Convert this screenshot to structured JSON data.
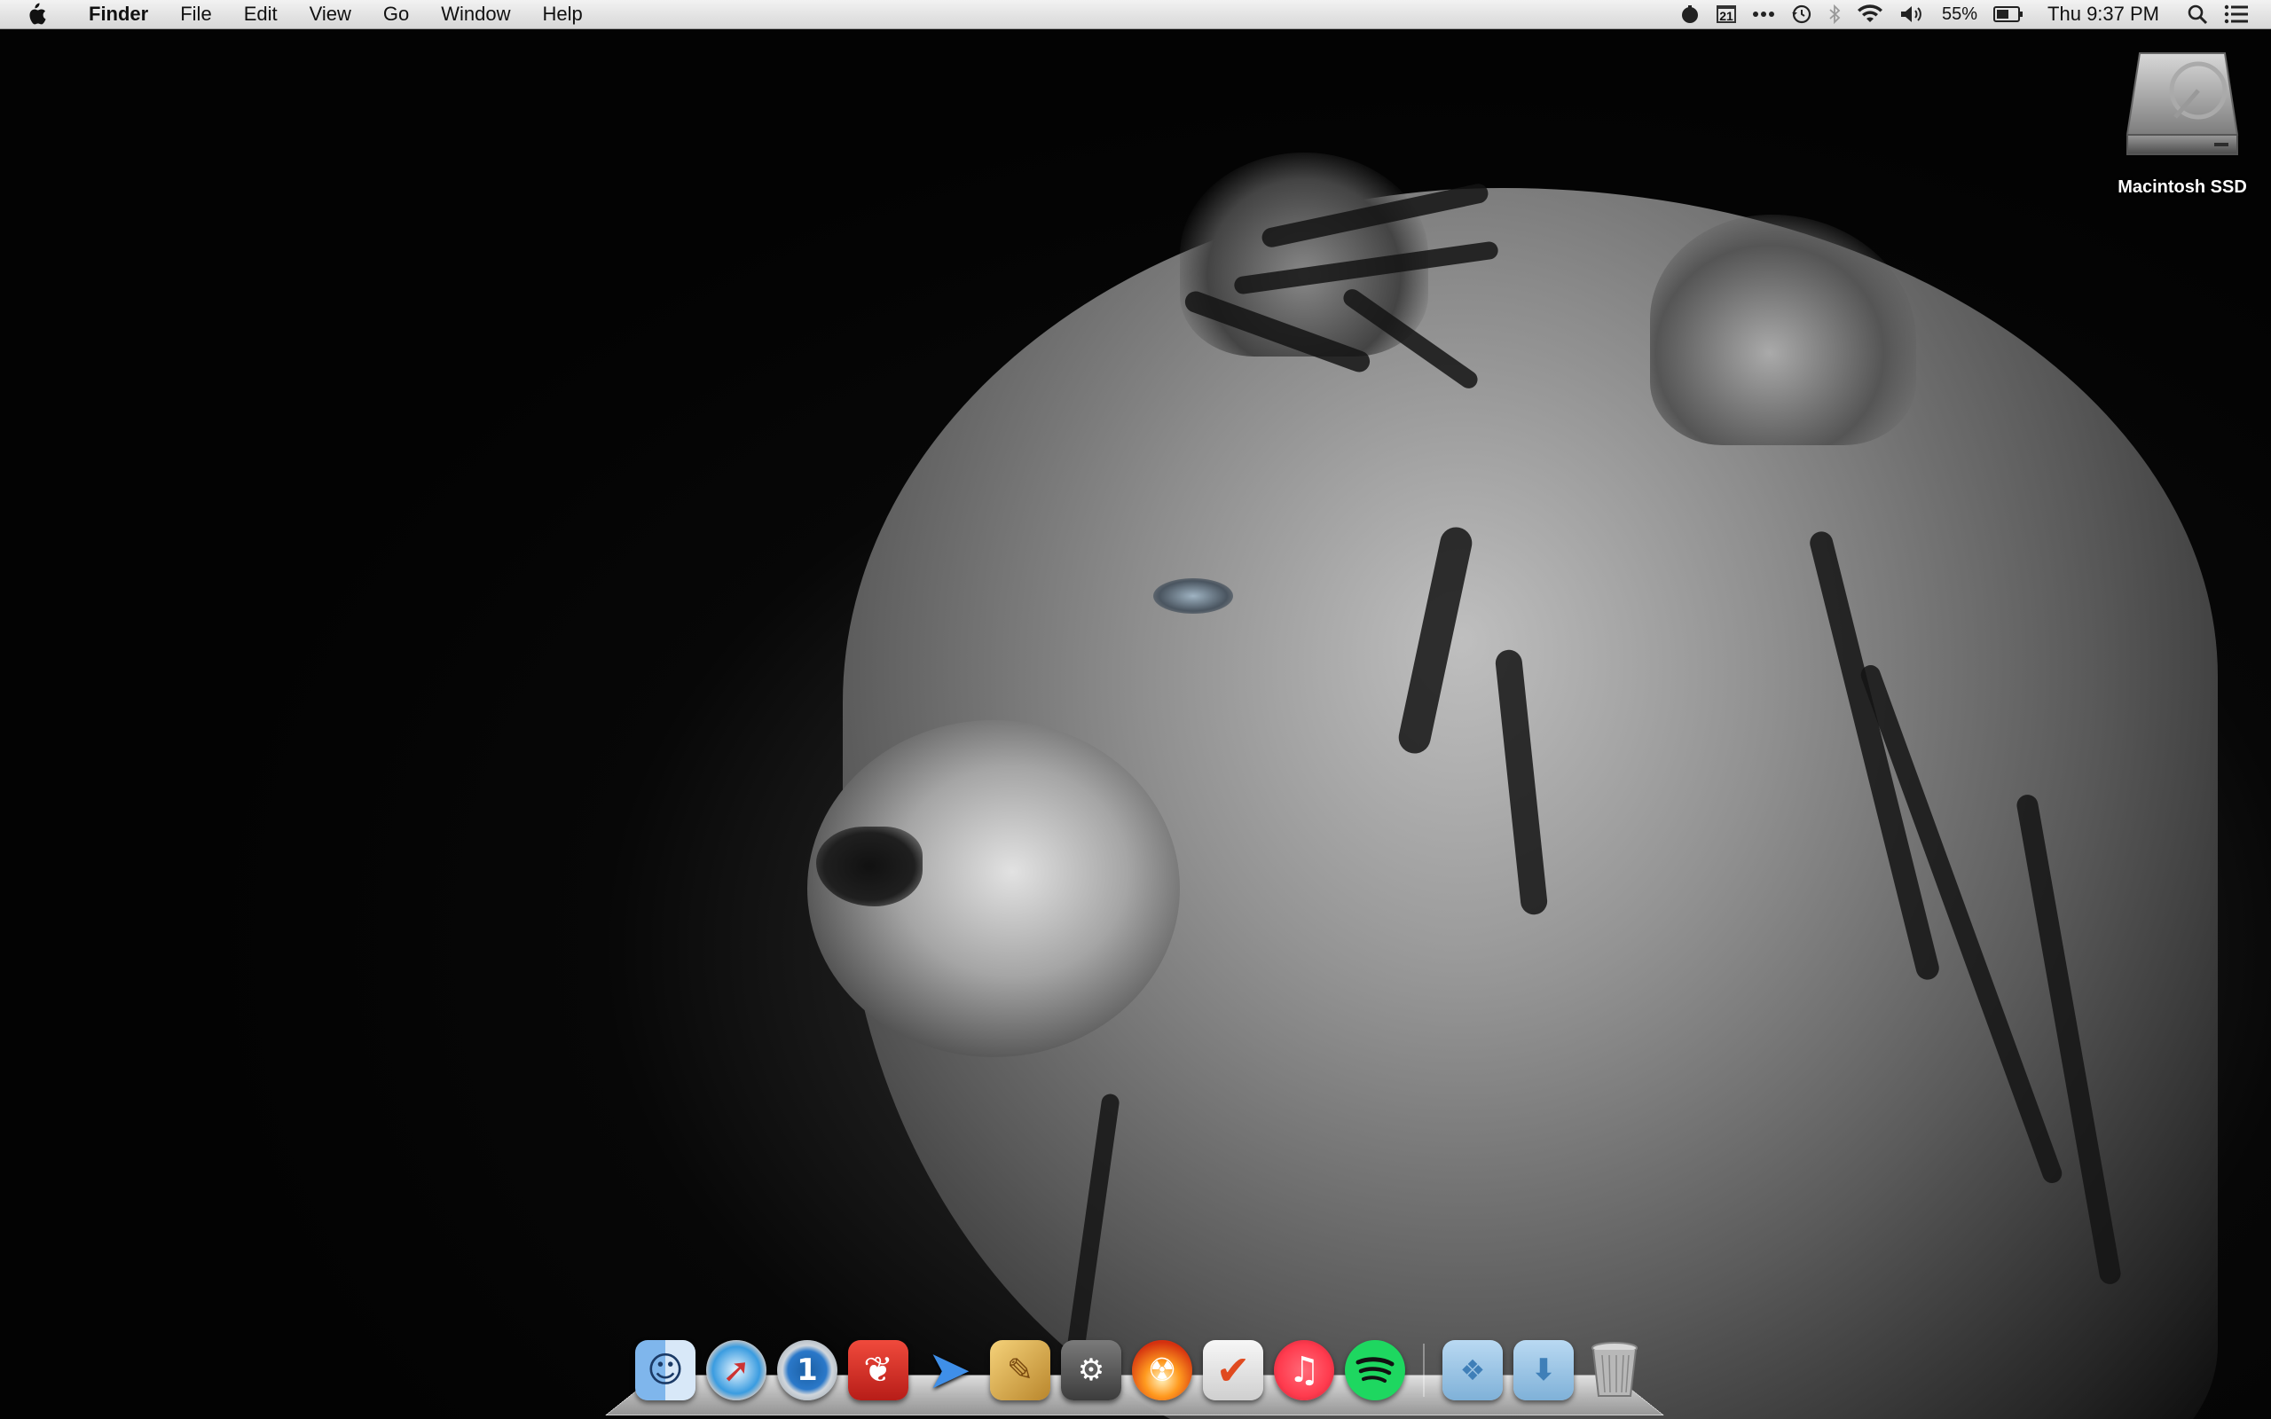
{
  "menubar": {
    "app_name": "Finder",
    "items": [
      "File",
      "Edit",
      "View",
      "Go",
      "Window",
      "Help"
    ],
    "calendar_day": "21",
    "battery_percent": "55%",
    "clock": "Thu 9:37 PM"
  },
  "desktop": {
    "drive_label": "Macintosh SSD"
  },
  "dock": {
    "apps": [
      {
        "name": "Finder",
        "icon": "finder-icon"
      },
      {
        "name": "Safari",
        "icon": "safari-icon"
      },
      {
        "name": "1Password",
        "icon": "1password-icon"
      },
      {
        "name": "Reeder",
        "icon": "reeder-icon"
      },
      {
        "name": "Airmail",
        "icon": "airmail-icon"
      },
      {
        "name": "iPhoto",
        "icon": "iphoto-icon"
      },
      {
        "name": "Steam",
        "icon": "steam-icon"
      },
      {
        "name": "Burn",
        "icon": "burn-icon"
      },
      {
        "name": "Wunderlist",
        "icon": "wunderlist-icon"
      },
      {
        "name": "iTunes",
        "icon": "itunes-icon"
      },
      {
        "name": "Spotify",
        "icon": "spotify-icon"
      }
    ],
    "stacks": [
      {
        "name": "Dropbox",
        "icon": "dropbox-folder-icon"
      },
      {
        "name": "Downloads",
        "icon": "downloads-folder-icon"
      },
      {
        "name": "Trash",
        "icon": "trash-icon"
      }
    ]
  },
  "colors": {
    "menubar": "#e6e6e6",
    "desktop_background": "#050505",
    "itunes": "#ff3b4e",
    "spotify": "#1ed760",
    "reeder": "#e0322c"
  }
}
